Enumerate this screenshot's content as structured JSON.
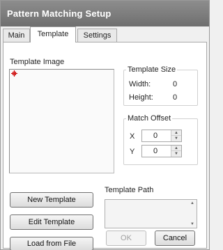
{
  "window": {
    "title": "Pattern Matching Setup"
  },
  "tabs": [
    {
      "label": "Main",
      "active": false
    },
    {
      "label": "Template",
      "active": true
    },
    {
      "label": "Settings",
      "active": false
    }
  ],
  "template_image": {
    "label": "Template Image"
  },
  "template_size": {
    "title": "Template Size",
    "width_label": "Width:",
    "width_value": "0",
    "height_label": "Height:",
    "height_value": "0"
  },
  "match_offset": {
    "title": "Match Offset",
    "x_label": "X",
    "x_value": "0",
    "y_label": "Y",
    "y_value": "0"
  },
  "template_path": {
    "label": "Template Path",
    "value": ""
  },
  "buttons": {
    "new_template": "New Template",
    "edit_template": "Edit Template",
    "load_from_file": "Load from File",
    "ok": "OK",
    "cancel": "Cancel"
  },
  "colors": {
    "titlebar": "#7d7d7d",
    "crosshair": "#cc0000",
    "panel_background": "#ffffff"
  },
  "icons": {
    "crosshair": "crosshair-icon",
    "spin_up": "spin-up-arrow-icon",
    "spin_down": "spin-down-arrow-icon",
    "scroll_up": "scroll-up-arrow-icon",
    "scroll_down": "scroll-down-arrow-icon"
  }
}
